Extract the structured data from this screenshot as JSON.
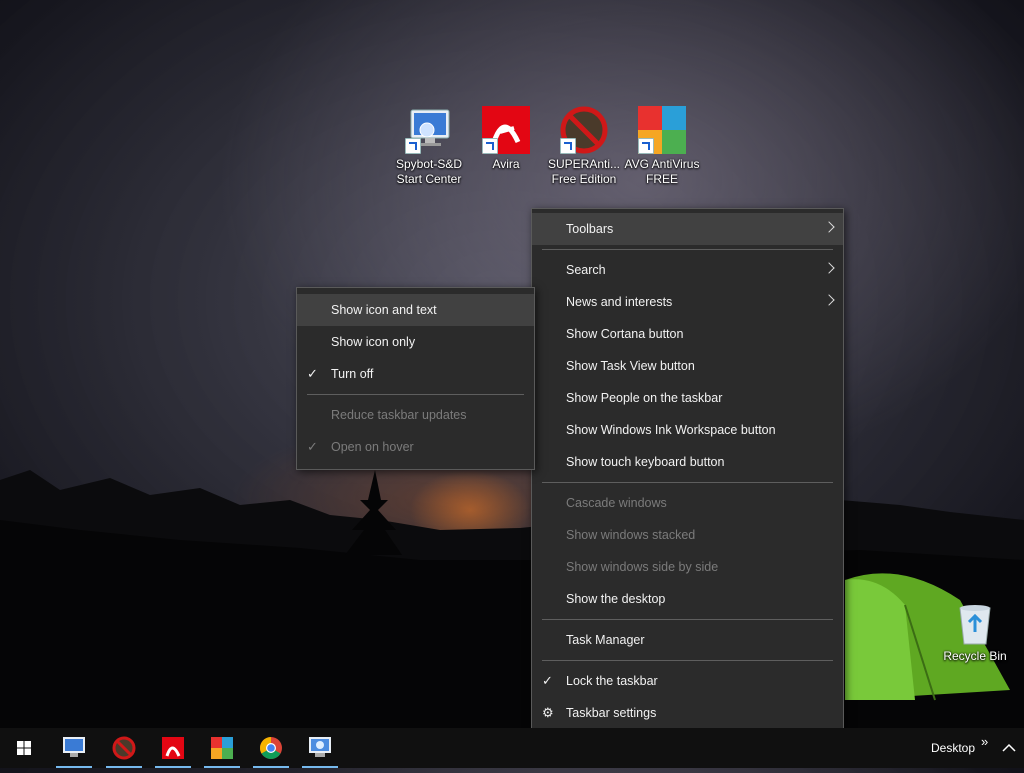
{
  "desktop": {
    "icons": [
      {
        "label_line1": "Spybot-S&D",
        "label_line2": "Start Center",
        "icon": "spybot-icon"
      },
      {
        "label_line1": "Avira",
        "label_line2": "",
        "icon": "avira-icon"
      },
      {
        "label_line1": "SUPERAnti...",
        "label_line2": "Free Edition",
        "icon": "superantispyware-icon"
      },
      {
        "label_line1": "AVG AntiVirus",
        "label_line2": "FREE",
        "icon": "avg-icon"
      },
      {
        "label_line1": "Recycle Bin",
        "label_line2": "",
        "icon": "recycle-bin-icon"
      }
    ]
  },
  "main_menu": {
    "items": [
      {
        "label": "Toolbars"
      },
      {
        "label": "Search"
      },
      {
        "label": "News and interests"
      },
      {
        "label": "Show Cortana button"
      },
      {
        "label": "Show Task View button"
      },
      {
        "label": "Show People on the taskbar"
      },
      {
        "label": "Show Windows Ink Workspace button"
      },
      {
        "label": "Show touch keyboard button"
      },
      {
        "label": "Cascade windows"
      },
      {
        "label": "Show windows stacked"
      },
      {
        "label": "Show windows side by side"
      },
      {
        "label": "Show the desktop"
      },
      {
        "label": "Task Manager"
      },
      {
        "label": "Lock the taskbar",
        "checked": true
      },
      {
        "label": "Taskbar settings"
      }
    ]
  },
  "submenu": {
    "items": [
      {
        "label": "Show icon and text"
      },
      {
        "label": "Show icon only"
      },
      {
        "label": "Turn off",
        "checked": true
      },
      {
        "label": "Reduce taskbar updates"
      },
      {
        "label": "Open on hover",
        "checked": true
      }
    ]
  },
  "taskbar": {
    "desktop_label": "Desktop",
    "overflow_glyph": "»",
    "tray_chevron": "^",
    "pinned_apps": [
      "spybot-icon",
      "superantispyware-icon",
      "avira-icon",
      "avg-icon",
      "chrome-icon",
      "spybot-monitor-icon"
    ]
  },
  "colors": {
    "menu_bg": "#2b2b2b",
    "menu_highlight": "#414141",
    "disabled_text": "#7b7b7b",
    "taskbar_bg": "#101010",
    "running_indicator": "#76b9ed"
  }
}
